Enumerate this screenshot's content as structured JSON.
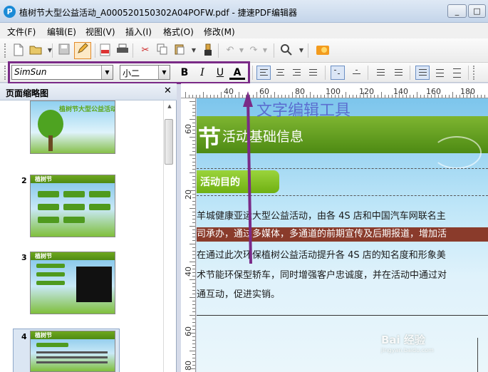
{
  "window": {
    "title": "植树节大型公益活动_A000520150302A04POFW.pdf - 捷速PDF编辑器",
    "app_icon_glyph": "P",
    "minimize": "_",
    "maximize": "□",
    "close": "✕"
  },
  "menu": [
    {
      "label": "文件(F)"
    },
    {
      "label": "编辑(E)"
    },
    {
      "label": "视图(V)"
    },
    {
      "label": "插入(I)"
    },
    {
      "label": "格式(O)"
    },
    {
      "label": "修改(M)"
    }
  ],
  "font_toolbar": {
    "font_family": "SimSun",
    "font_size": "小二",
    "bold": "B",
    "italic": "I",
    "underline": "U",
    "text_color": "A"
  },
  "icons": {
    "new": "new-document-icon",
    "open": "open-folder-icon",
    "save": "save-icon",
    "edit": "edit-pencil-icon",
    "pdf": "pdf-convert-icon",
    "print": "print-icon",
    "cut": "scissors-icon",
    "copy": "copy-icon",
    "paste": "paste-icon",
    "brush": "format-brush-icon",
    "undo": "undo-icon",
    "redo": "redo-icon",
    "zoom": "zoom-icon",
    "vip": "vip-coin-icon"
  },
  "thumb_panel": {
    "title": "页面缩略图",
    "close": "✕",
    "pages": [
      {
        "num": "",
        "title": "植树节大型公益活动"
      },
      {
        "num": "2",
        "title": "植树节"
      },
      {
        "num": "3",
        "title": "植树节"
      },
      {
        "num": "4",
        "title": "植树节"
      }
    ]
  },
  "ruler": {
    "h_labels": [
      "40",
      "60",
      "80",
      "100",
      "120",
      "140",
      "160",
      "180"
    ],
    "v_labels": [
      "60",
      "20",
      "40",
      "60",
      "80"
    ]
  },
  "document": {
    "header_glyph": "节",
    "section_title": "活动基础信息",
    "purpose_label": "活动目的",
    "paragraph_lines": [
      "羊城健康亚运大型公益活动，由各 4S 店和中国汽车网联名主",
      "司承办，通过多媒体，多通道的前期宣传及后期报道，增加活",
      "在通过此次环保植树公益活动提升各 4S 店的知名度和形象美",
      "术节能环保型轿车，同时增强客户忠诚度，并在活动中通过对",
      "通互动，促进实销。"
    ]
  },
  "annotation": {
    "label": "文字编辑工具"
  },
  "watermark": {
    "main": "Bai 经验",
    "sub": "jingyan.baidu.com"
  },
  "colors": {
    "highlight_box": "#7a2a87",
    "annotation_text": "#5b6fd0",
    "doc_header_green": "#5a9a1a",
    "selected_text_bg": "#8a3b2b"
  }
}
